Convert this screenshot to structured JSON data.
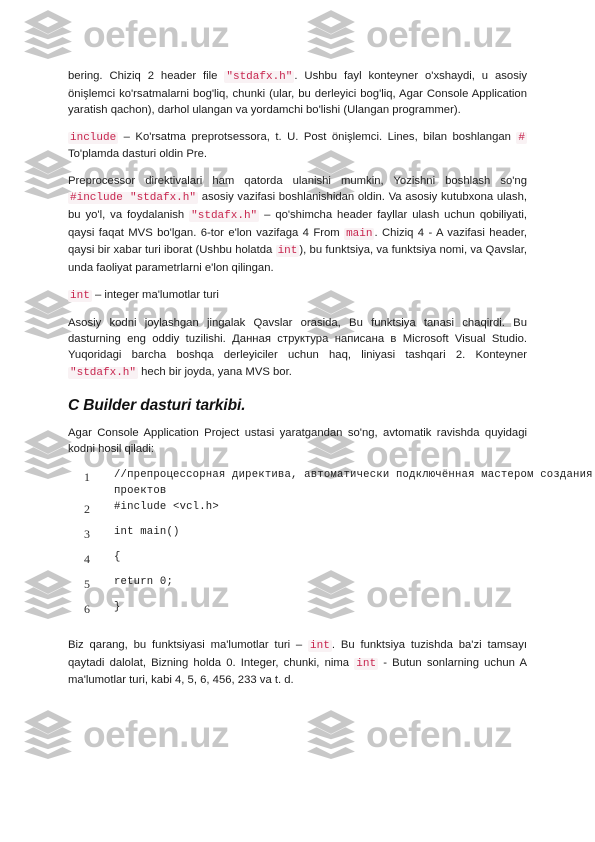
{
  "watermark": {
    "text": "oefen.uz",
    "logo_icon": "stacked-layers-icon",
    "color": "#c8c8c8"
  },
  "document": {
    "accent_code_color": "#c7254e",
    "code_bg_color": "#f9f2f4",
    "paragraphs": [
      {
        "id": "p1",
        "runs": [
          {
            "t": "bering. Chiziq 2 header file ",
            "code": false
          },
          {
            "t": "\"stdafx.h\"",
            "code": true
          },
          {
            "t": ". Ushbu fayl konteyner o'xshaydi, u asosiy önişlemci ko'rsatmalarni bog'liq, chunki (ular, bu derleyici bog'liq, Agar Console Application yaratish qachon), darhol ulangan va yordamchi bo'lishi (Ulangan programmer).",
            "code": false
          }
        ]
      },
      {
        "id": "p2",
        "runs": [
          {
            "t": "include",
            "code": true
          },
          {
            "t": " – Ko'rsatma preprotsessora, t. U. Post önişlemci. Lines, bilan boshlangan ",
            "code": false
          },
          {
            "t": "#",
            "code": true
          },
          {
            "t": " To'plamda dasturi oldin Pre.",
            "code": false
          }
        ]
      },
      {
        "id": "p3",
        "runs": [
          {
            "t": "Preprocessor direktivalari ham qatorda ulanishi mumkin, Yozishni boshlash so'ng ",
            "code": false
          },
          {
            "t": "#include \"stdafx.h\"",
            "code": true
          },
          {
            "t": " asosiy vazifasi boshlanishidan oldin. Va asosiy kutubxona ulash, bu yo'l, va foydalanish ",
            "code": false
          },
          {
            "t": "\"stdafx.h\"",
            "code": true
          },
          {
            "t": " – qo'shimcha header fayllar ulash uchun qobiliyati, qaysi faqat MVS bo'lgan. 6-tor e'lon vazifaga 4 From ",
            "code": false
          },
          {
            "t": "main",
            "code": true
          },
          {
            "t": ". Chiziq 4 - A vazifasi header, qaysi bir xabar turi iborat (Ushbu holatda ",
            "code": false
          },
          {
            "t": "int",
            "code": true
          },
          {
            "t": "), bu funktsiya, va funktsiya nomi, va Qavslar, unda faoliyat parametrlarni e'lon qilingan.",
            "code": false
          }
        ]
      },
      {
        "id": "p4",
        "runs": [
          {
            "t": "int",
            "code": true
          },
          {
            "t": " – integer ma'lumotlar turi",
            "code": false
          }
        ]
      },
      {
        "id": "p5",
        "runs": [
          {
            "t": "Asosiy kodni joylashgan jingalak Qavslar orasida, Bu funktsiya tanasi chaqirdi. Bu dasturning eng oddiy tuzilishi. Данная структура написана в Microsoft Visual Studio. Yuqoridagi barcha boshqa derleyiciler uchun haq, liniyasi tashqari 2. Konteyner ",
            "code": false
          },
          {
            "t": "\"stdafx.h\"",
            "code": true
          },
          {
            "t": " hech bir joyda, yana MVS bor.",
            "code": false
          }
        ]
      }
    ],
    "heading": "C Builder dasturi tarkibi.",
    "intro_paragraph": {
      "id": "p6",
      "runs": [
        {
          "t": "Agar Console Application Project ustasi yaratgandan so'ng, avtomatik ravishda quyidagi kodni hosil qiladi:",
          "code": false
        }
      ]
    },
    "code_listing": {
      "lines": [
        {
          "num": "1",
          "text": "//препроцессорная директива, автоматически подключённая мастером создания  проектов",
          "wrap": true
        },
        {
          "num": "2",
          "text": "#include <vcl.h>",
          "wrap": false
        },
        {
          "num": "3",
          "text": "int main()",
          "wrap": false
        },
        {
          "num": "4",
          "text": "{",
          "wrap": false
        },
        {
          "num": "5",
          "text": "return 0;",
          "wrap": false
        },
        {
          "num": "6",
          "text": "}",
          "wrap": false
        }
      ]
    },
    "closing_paragraph": {
      "id": "p7",
      "runs": [
        {
          "t": "Biz qarang, bu funktsiyasi ma'lumotlar turi – ",
          "code": false
        },
        {
          "t": "int",
          "code": true
        },
        {
          "t": ". Bu funktsiya tuzishda ba'zi tamsayı qaytadi dalolat, Bizning holda 0. Integer, chunki, nima ",
          "code": false
        },
        {
          "t": "int",
          "code": true
        },
        {
          "t": " - Butun sonlarning uchun A ma'lumotlar turi, kabi 4, 5, 6, 456, 233 va t. d.",
          "code": false
        }
      ]
    }
  }
}
